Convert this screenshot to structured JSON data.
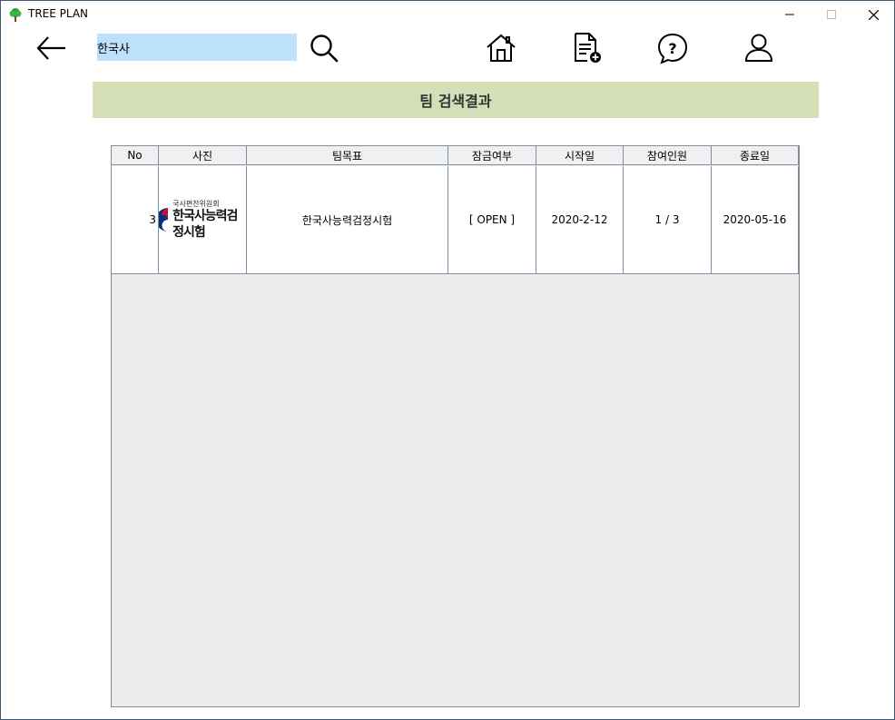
{
  "window": {
    "title": "TREE PLAN"
  },
  "search": {
    "value": "한국사"
  },
  "banner": {
    "title": "팀 검색결과"
  },
  "table": {
    "columns": [
      "No",
      "사진",
      "팀목표",
      "잠금여부",
      "시작일",
      "참여인원",
      "종료일"
    ],
    "rows": [
      {
        "no": "3",
        "photo": {
          "small_text": "국사편찬위원회",
          "big_text": "한국사능력검정시험"
        },
        "goal": "한국사능력검정시험",
        "lock": "[ OPEN ]",
        "start": "2020-2-12",
        "members": "1 / 3",
        "end": "2020-05-16"
      }
    ]
  },
  "icons": {
    "app": "tree-icon",
    "back": "arrow-left-icon",
    "search": "search-icon",
    "home": "home-icon",
    "document": "document-add-icon",
    "help": "question-icon",
    "user": "user-icon"
  },
  "colors": {
    "search_bg": "#bde0fb",
    "banner_bg": "#d4dfb7",
    "grid_bg": "#ececec",
    "grid_border": "#7b8ea3"
  }
}
